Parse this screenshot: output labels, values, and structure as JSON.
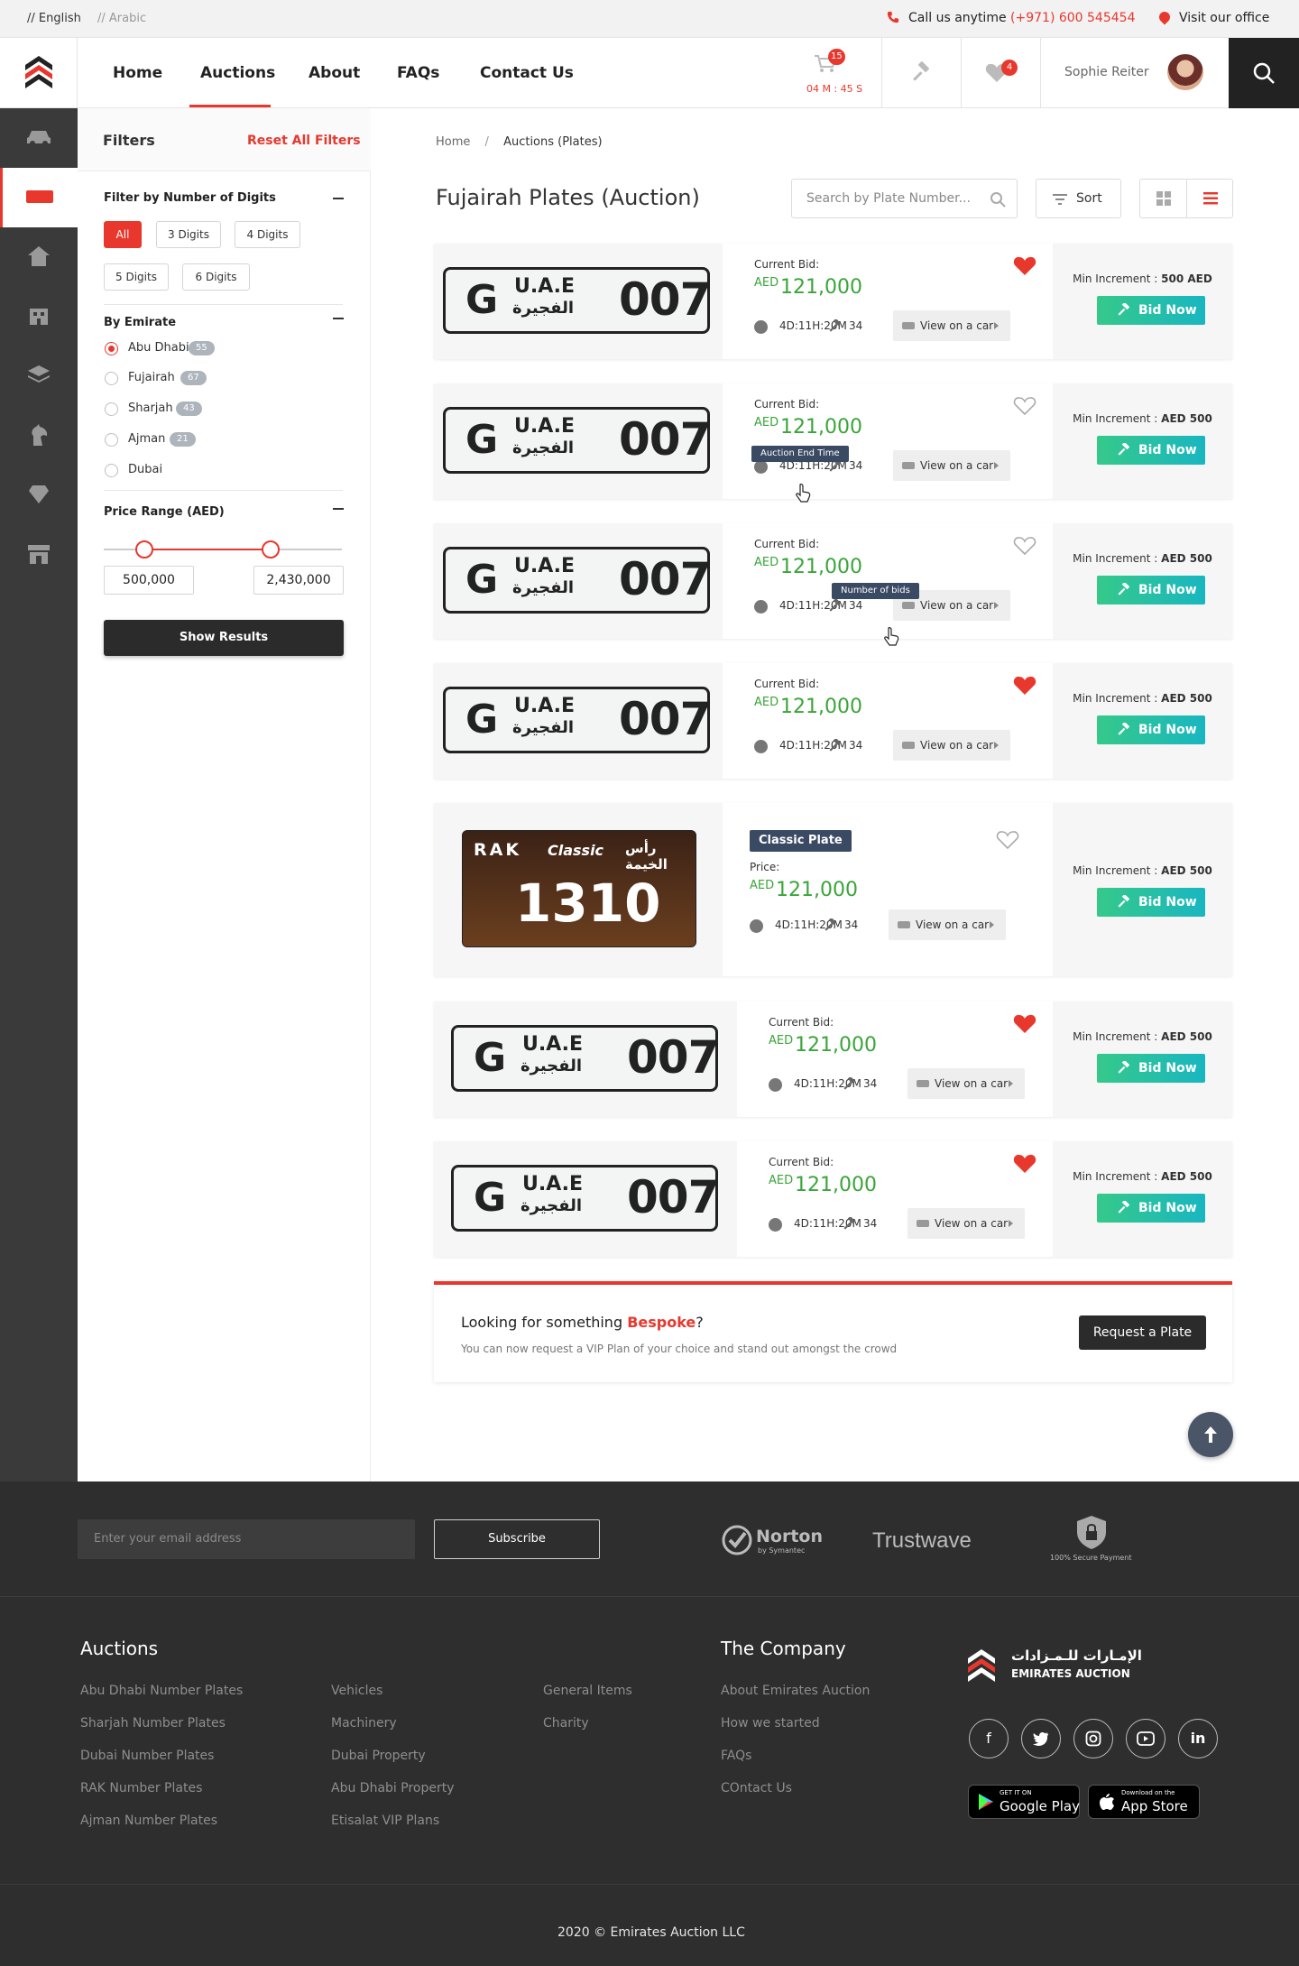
{
  "topbar": {
    "lang_en": "// English",
    "lang_ar": "// Arabic",
    "call_label": "Call us anytime",
    "phone": "(+971) 600 545454",
    "visit_label": "Visit our office"
  },
  "nav": {
    "items": [
      "Home",
      "Auctions",
      "About",
      "FAQs",
      "Contact Us"
    ],
    "active": "Auctions",
    "cart_count": "15",
    "cart_timer": "04 M : 45 S",
    "wishlist_count": "4",
    "user_name": "Sophie Reiter"
  },
  "filters": {
    "title": "Filters",
    "reset": "Reset All Filters",
    "digits_heading": "Filter by Number of Digits",
    "digit_chips": [
      "All",
      "3 Digits",
      "4 Digits",
      "5 Digits",
      "6 Digits"
    ],
    "emirate_heading": "By Emirate",
    "emirates": [
      {
        "name": "Abu Dhabi",
        "count": "55",
        "selected": true
      },
      {
        "name": "Fujairah",
        "count": "67",
        "selected": false
      },
      {
        "name": "Sharjah",
        "count": "43",
        "selected": false
      },
      {
        "name": "Ajman",
        "count": "21",
        "selected": false
      },
      {
        "name": "Dubai",
        "count": "",
        "selected": false
      }
    ],
    "price_heading": "Price Range (AED)",
    "price_min": "500,000",
    "price_max": "2,430,000",
    "slider_low_fraction": 0.17,
    "slider_high_fraction": 0.7,
    "show_results": "Show Results"
  },
  "main": {
    "breadcrumb": [
      "Home",
      "Auctions (Plates)"
    ],
    "title": "Fujairah Plates (Auction)",
    "search_placeholder": "Search by Plate Number...",
    "sort_label": "Sort"
  },
  "plate": {
    "letter": "G",
    "country": "U.A.E",
    "emirate_ar": "الفجيرة",
    "number": "007"
  },
  "classic_plate": {
    "emirate_en": "RAK",
    "emirate_ar": "رأس الخيمة",
    "brand": "Classic",
    "number": "1310"
  },
  "listings": [
    {
      "type": "standard",
      "label": "Current Bid:",
      "currency": "AED",
      "amount": "121,000",
      "time": "4D:11H:20M",
      "bids": "34",
      "view_car": "View on a car",
      "min_inc_label": "Min Increment :",
      "min_inc": "500 AED",
      "bid": "Bid Now",
      "fav": true
    },
    {
      "type": "standard",
      "label": "Current Bid:",
      "currency": "AED",
      "amount": "121,000",
      "time": "4D:11H:20M",
      "bids": "34",
      "view_car": "View on a car",
      "min_inc_label": "Min Increment :",
      "min_inc": "AED 500",
      "bid": "Bid Now",
      "fav": false,
      "tooltip": "Auction End Time"
    },
    {
      "type": "standard",
      "label": "Current Bid:",
      "currency": "AED",
      "amount": "121,000",
      "time": "4D:11H:20M",
      "bids": "34",
      "view_car": "View on a car",
      "min_inc_label": "Min Increment :",
      "min_inc": "AED 500",
      "bid": "Bid Now",
      "fav": false,
      "tooltip": "Number of bids"
    },
    {
      "type": "standard",
      "label": "Current Bid:",
      "currency": "AED",
      "amount": "121,000",
      "time": "4D:11H:20M",
      "bids": "34",
      "view_car": "View on a car",
      "min_inc_label": "Min Increment :",
      "min_inc": "AED 500",
      "bid": "Bid Now",
      "fav": true
    },
    {
      "type": "classic",
      "tag": "Classic Plate",
      "label": "Price:",
      "currency": "AED",
      "amount": "121,000",
      "time": "4D:11H:20M",
      "bids": "34",
      "view_car": "View on a car",
      "min_inc_label": "Min Increment :",
      "min_inc": "AED 500",
      "bid": "Bid Now",
      "fav": false
    },
    {
      "type": "standard",
      "label": "Current Bid:",
      "currency": "AED",
      "amount": "121,000",
      "time": "4D:11H:20M",
      "bids": "34",
      "view_car": "View on a car",
      "min_inc_label": "Min Increment :",
      "min_inc": "AED 500",
      "bid": "Bid Now",
      "fav": true
    },
    {
      "type": "standard",
      "label": "Current Bid:",
      "currency": "AED",
      "amount": "121,000",
      "time": "4D:11H:20M",
      "bids": "34",
      "view_car": "View on a car",
      "min_inc_label": "Min Increment :",
      "min_inc": "AED 500",
      "bid": "Bid Now",
      "fav": true
    }
  ],
  "bespoke": {
    "text_before": "Looking for something ",
    "highlight": "Bespoke",
    "text_after": "?",
    "subtext": "You can now request a VIP Plan of your choice and stand out amongst the crowd",
    "button": "Request a Plate"
  },
  "footer": {
    "email_placeholder": "Enter your email address",
    "subscribe": "Subscribe",
    "norton": "Norton",
    "norton_sub": "by Symantec",
    "trustwave": "Trustwave",
    "secure": "100% Secure Payment",
    "auctions_heading": "Auctions",
    "col1": [
      "Abu Dhabi Number Plates",
      "Sharjah Number Plates",
      "Dubai Number Plates",
      "RAK Number Plates",
      "Ajman Number Plates"
    ],
    "col2": [
      "Vehicles",
      "Machinery",
      "Dubai Property",
      "Abu Dhabi Property",
      "Etisalat VIP Plans"
    ],
    "col3": [
      "General Items",
      "Charity"
    ],
    "company_heading": "The Company",
    "col4": [
      "About Emirates Auction",
      "How we started",
      "FAQs",
      "COntact Us"
    ],
    "brand_ar": "الإمـارات للـمـزادات",
    "brand_en": "EMIRATES AUCTION",
    "google_small": "GET IT ON",
    "google_big": "Google Play",
    "apple_small": "Download on the",
    "apple_big": "App Store",
    "copyright": "2020 © Emirates Auction LLC"
  },
  "colors": {
    "accent": "#e8382e",
    "green": "#3aa53a",
    "dark": "#2e2e2e"
  }
}
